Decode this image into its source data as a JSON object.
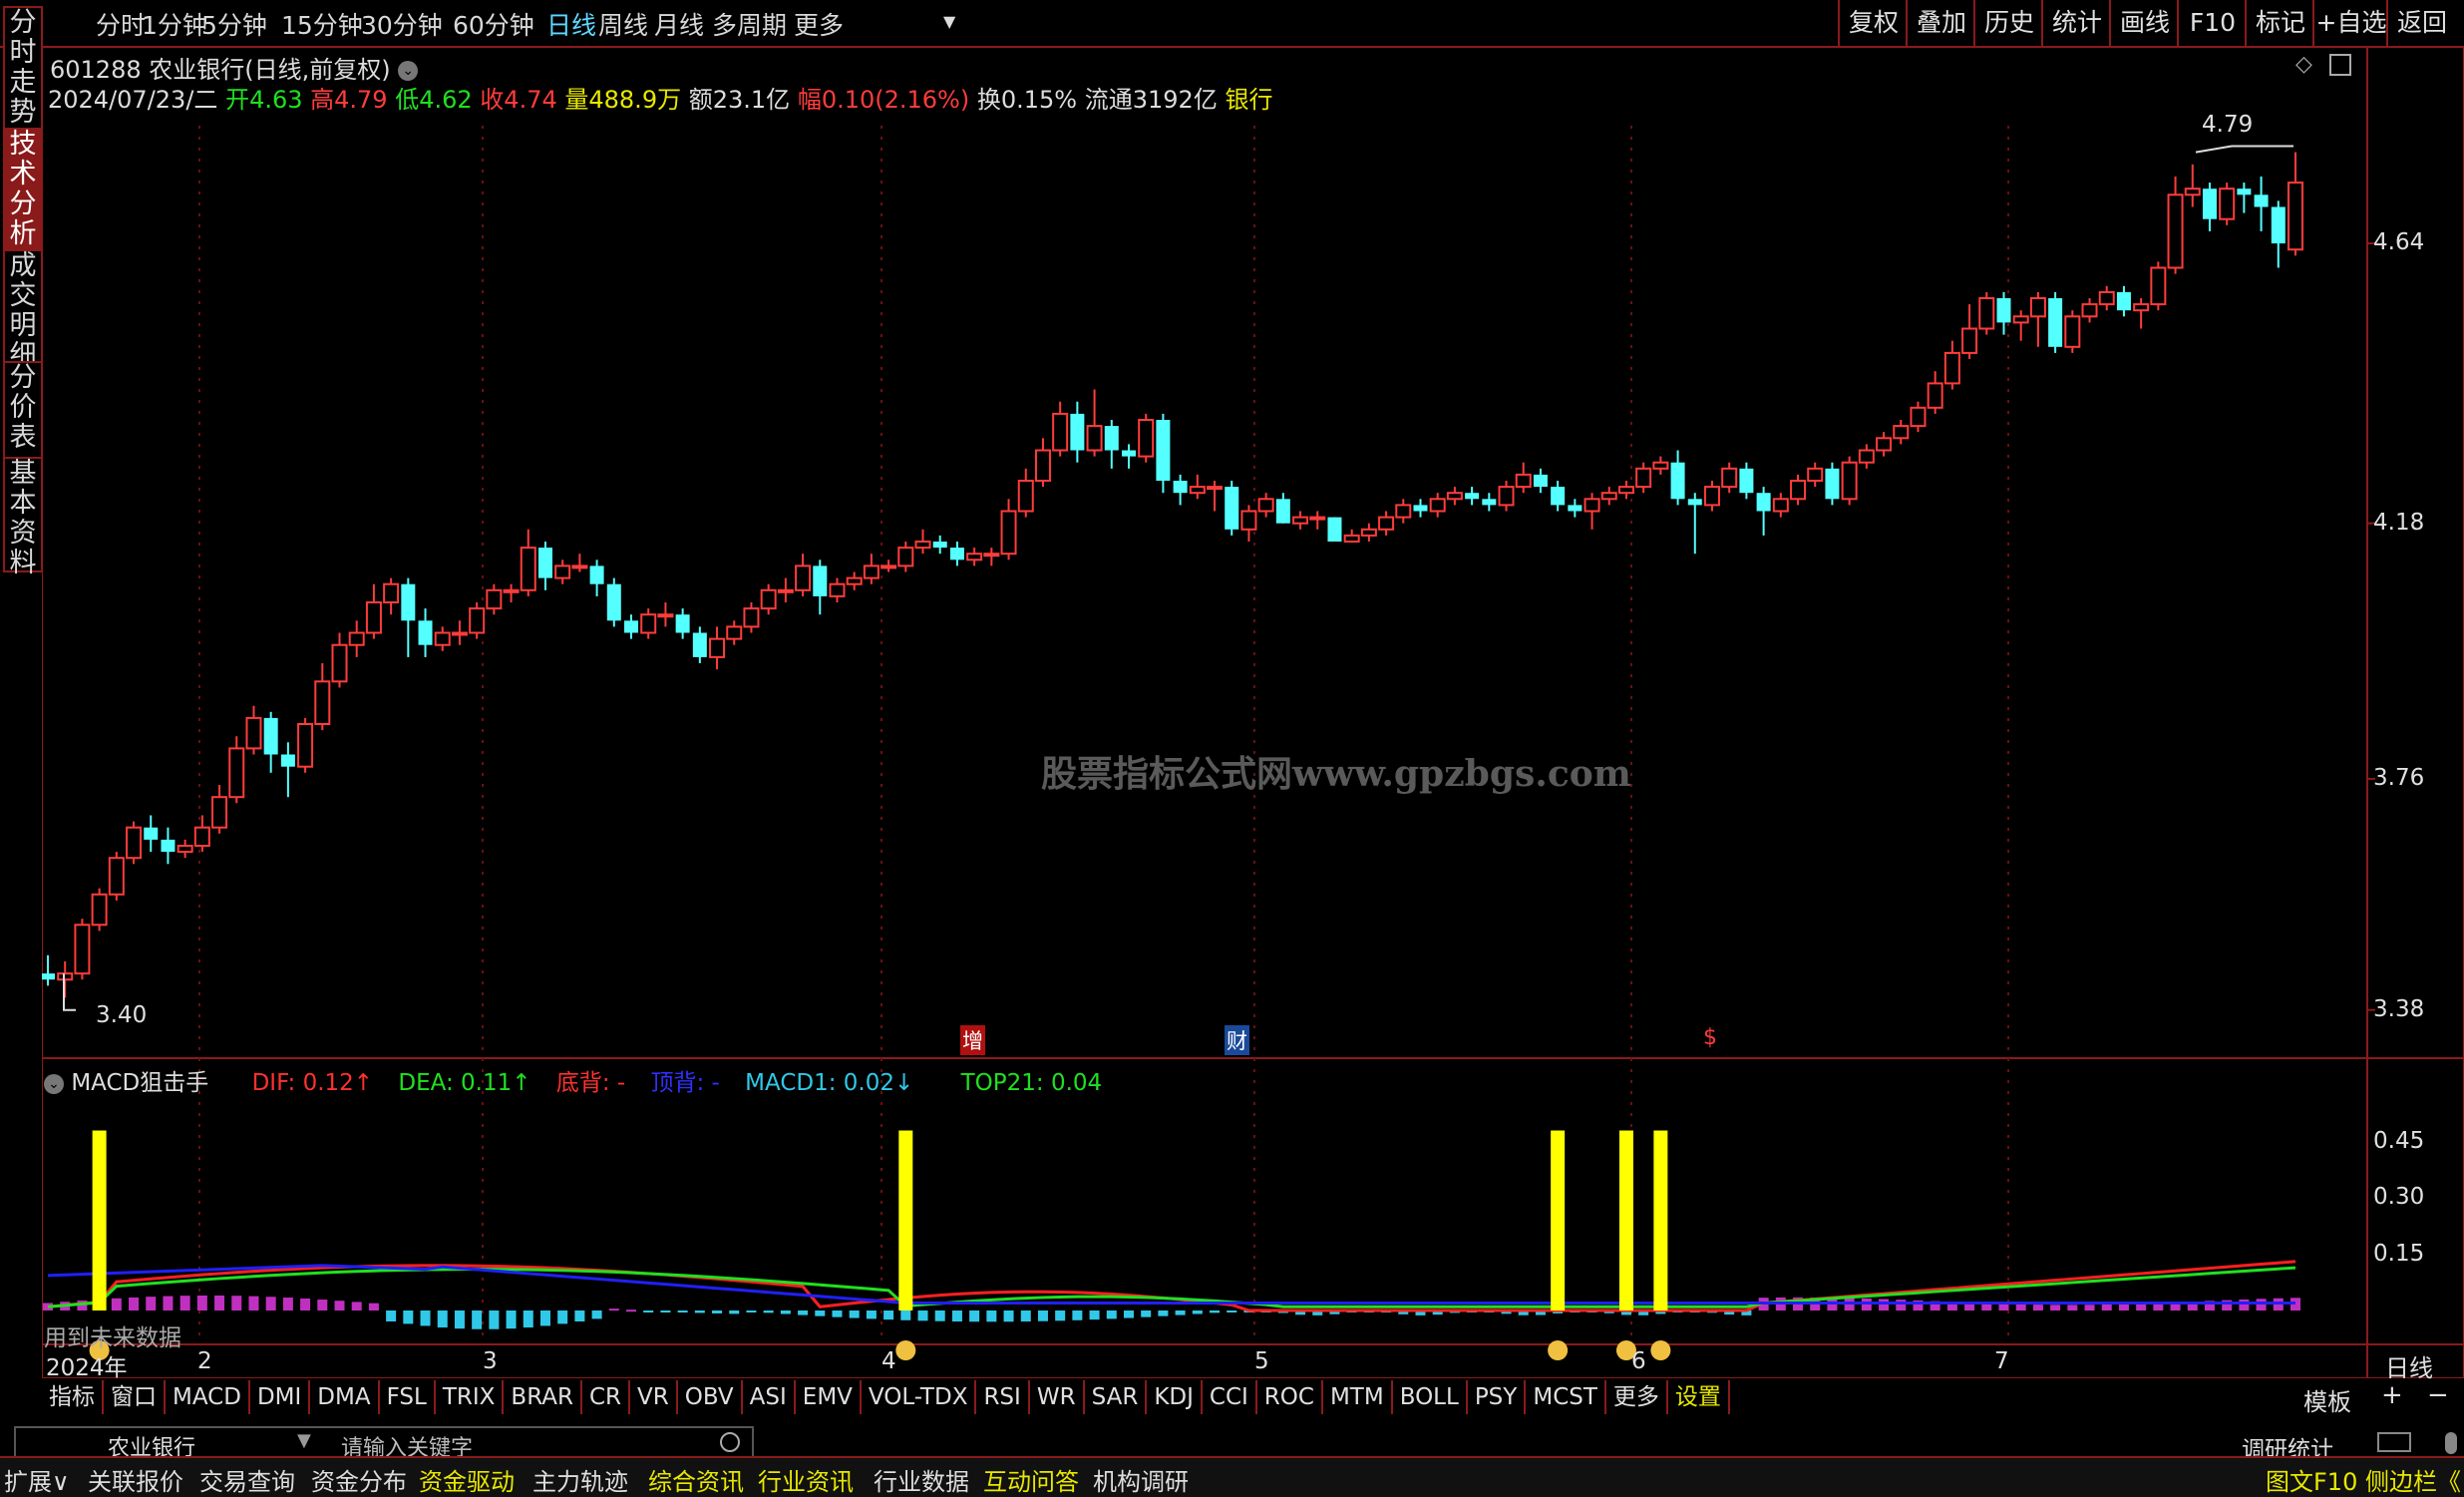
{
  "topbar": {
    "tabs": [
      "分时",
      "1分钟",
      "5分钟",
      "15分钟",
      "30分钟",
      "60分钟",
      "日线",
      "周线",
      "月线",
      "多周期",
      "更多"
    ],
    "active_tab": "日线",
    "right_buttons": [
      "复权",
      "叠加",
      "历史",
      "统计",
      "画线",
      "F10",
      "标记",
      "+自选",
      "返回"
    ]
  },
  "left_tabs": [
    "分时走势",
    "技术分析",
    "成交明细",
    "分价表",
    "基本资料"
  ],
  "left_active": "技术分析",
  "stock": {
    "code_name": "601288 农业银行(日线,前复权)",
    "date": "2024/07/23/二",
    "open_label": "开",
    "open": "4.63",
    "high_label": "高",
    "high": "4.79",
    "low_label": "低",
    "low": "4.62",
    "close_label": "收",
    "close": "4.74",
    "vol_label": "量",
    "vol": "488.9万",
    "amount_label": "额",
    "amount": "23.1亿",
    "change_label": "幅",
    "change": "0.10(2.16%)",
    "turnover": "换0.15%",
    "float_label": "流通",
    "float": "3192亿",
    "sector": "银行"
  },
  "watermark": "股票指标公式网www.gpzbgs.com",
  "price_axis": [
    "4.64",
    "4.18",
    "3.76",
    "3.38"
  ],
  "marks": {
    "low": "3.40",
    "high": "4.79",
    "zeng": "增",
    "cai": "财",
    "s": "$"
  },
  "macd": {
    "name": "MACD狙击手",
    "dif": "DIF: 0.12↑",
    "dea": "DEA: 0.11↑",
    "dibei": "底背: -",
    "dingbei": "顶背: -",
    "macd1": "MACD1: 0.02↓",
    "top21": "TOP21: 0.04",
    "axis": [
      "0.45",
      "0.30",
      "0.15"
    ],
    "note": "用到未来数据"
  },
  "x_axis": {
    "labels": [
      "2024年",
      "2",
      "3",
      "4",
      "5",
      "6",
      "7"
    ],
    "period": "日线"
  },
  "indicator_tabs": [
    "指标",
    "窗口",
    "MACD",
    "DMI",
    "DMA",
    "FSL",
    "TRIX",
    "BRAR",
    "CR",
    "VR",
    "OBV",
    "ASI",
    "EMV",
    "VOL-TDX",
    "RSI",
    "WR",
    "SAR",
    "KDJ",
    "CCI",
    "ROC",
    "MTM",
    "BOLL",
    "PSY",
    "MCST",
    "更多",
    "设置"
  ],
  "template_btn": "模板",
  "search": {
    "name": "农业银行",
    "placeholder": "请输入关键字",
    "right": "调研统计"
  },
  "bottom_tabs": [
    "扩展∨",
    "关联报价",
    "交易查询",
    "资金分布",
    "资金驱动",
    "主力轨迹",
    "综合资讯",
    "行业资讯",
    "行业数据",
    "互动问答",
    "机构调研"
  ],
  "bottom_right": [
    "图文F10",
    "侧边栏《"
  ],
  "colors": {
    "up": "#ff3c3c",
    "down": "#54ffff",
    "border": "#8b1a1a",
    "dif": "#ff2020",
    "dea": "#20e020",
    "yellow": "#ffff00"
  },
  "chart_data": {
    "type": "candlestick",
    "ylim": [
      3.35,
      4.85
    ],
    "candles": [
      [
        3.44,
        3.43,
        3.47,
        3.42
      ],
      [
        3.43,
        3.44,
        3.46,
        3.4
      ],
      [
        3.44,
        3.52,
        3.53,
        3.43
      ],
      [
        3.52,
        3.57,
        3.58,
        3.51
      ],
      [
        3.57,
        3.63,
        3.64,
        3.56
      ],
      [
        3.63,
        3.68,
        3.69,
        3.62
      ],
      [
        3.68,
        3.66,
        3.7,
        3.64
      ],
      [
        3.66,
        3.64,
        3.68,
        3.62
      ],
      [
        3.64,
        3.65,
        3.66,
        3.63
      ],
      [
        3.65,
        3.68,
        3.7,
        3.64
      ],
      [
        3.68,
        3.73,
        3.75,
        3.67
      ],
      [
        3.73,
        3.81,
        3.83,
        3.72
      ],
      [
        3.81,
        3.86,
        3.88,
        3.8
      ],
      [
        3.86,
        3.8,
        3.87,
        3.77
      ],
      [
        3.8,
        3.78,
        3.82,
        3.73
      ],
      [
        3.78,
        3.85,
        3.86,
        3.77
      ],
      [
        3.85,
        3.92,
        3.95,
        3.84
      ],
      [
        3.92,
        3.98,
        4.0,
        3.91
      ],
      [
        3.98,
        4.0,
        4.02,
        3.96
      ],
      [
        4.0,
        4.05,
        4.08,
        3.99
      ],
      [
        4.05,
        4.08,
        4.09,
        4.03
      ],
      [
        4.08,
        4.02,
        4.09,
        3.96
      ],
      [
        4.02,
        3.98,
        4.04,
        3.96
      ],
      [
        3.98,
        4.0,
        4.01,
        3.97
      ],
      [
        4.0,
        4.0,
        4.02,
        3.98
      ],
      [
        4.0,
        4.04,
        4.05,
        3.99
      ],
      [
        4.04,
        4.07,
        4.08,
        4.03
      ],
      [
        4.07,
        4.07,
        4.08,
        4.05
      ],
      [
        4.07,
        4.14,
        4.17,
        4.06
      ],
      [
        4.14,
        4.09,
        4.15,
        4.07
      ],
      [
        4.09,
        4.11,
        4.12,
        4.08
      ],
      [
        4.11,
        4.11,
        4.13,
        4.1
      ],
      [
        4.11,
        4.08,
        4.12,
        4.06
      ],
      [
        4.08,
        4.02,
        4.09,
        4.01
      ],
      [
        4.02,
        4.0,
        4.03,
        3.99
      ],
      [
        4.0,
        4.03,
        4.04,
        3.99
      ],
      [
        4.03,
        4.03,
        4.05,
        4.01
      ],
      [
        4.03,
        4.0,
        4.04,
        3.99
      ],
      [
        4.0,
        3.96,
        4.01,
        3.95
      ],
      [
        3.96,
        3.99,
        4.01,
        3.94
      ],
      [
        3.99,
        4.01,
        4.02,
        3.98
      ],
      [
        4.01,
        4.04,
        4.05,
        4.0
      ],
      [
        4.04,
        4.07,
        4.08,
        4.03
      ],
      [
        4.07,
        4.07,
        4.09,
        4.05
      ],
      [
        4.07,
        4.11,
        4.13,
        4.06
      ],
      [
        4.11,
        4.06,
        4.12,
        4.03
      ],
      [
        4.06,
        4.08,
        4.09,
        4.05
      ],
      [
        4.08,
        4.09,
        4.1,
        4.07
      ],
      [
        4.09,
        4.11,
        4.13,
        4.08
      ],
      [
        4.11,
        4.11,
        4.12,
        4.1
      ],
      [
        4.11,
        4.14,
        4.15,
        4.1
      ],
      [
        4.14,
        4.15,
        4.17,
        4.13
      ],
      [
        4.15,
        4.14,
        4.16,
        4.13
      ],
      [
        4.14,
        4.12,
        4.15,
        4.11
      ],
      [
        4.12,
        4.13,
        4.14,
        4.11
      ],
      [
        4.13,
        4.13,
        4.14,
        4.11
      ],
      [
        4.13,
        4.2,
        4.22,
        4.12
      ],
      [
        4.2,
        4.25,
        4.27,
        4.19
      ],
      [
        4.25,
        4.3,
        4.32,
        4.24
      ],
      [
        4.3,
        4.36,
        4.38,
        4.29
      ],
      [
        4.36,
        4.3,
        4.38,
        4.28
      ],
      [
        4.3,
        4.34,
        4.4,
        4.29
      ],
      [
        4.34,
        4.3,
        4.35,
        4.27
      ],
      [
        4.3,
        4.29,
        4.31,
        4.27
      ],
      [
        4.29,
        4.35,
        4.36,
        4.28
      ],
      [
        4.35,
        4.25,
        4.36,
        4.23
      ],
      [
        4.25,
        4.23,
        4.26,
        4.21
      ],
      [
        4.23,
        4.24,
        4.26,
        4.22
      ],
      [
        4.24,
        4.24,
        4.25,
        4.2
      ],
      [
        4.24,
        4.17,
        4.25,
        4.16
      ],
      [
        4.17,
        4.2,
        4.21,
        4.15
      ],
      [
        4.2,
        4.22,
        4.23,
        4.19
      ],
      [
        4.22,
        4.18,
        4.23,
        4.18
      ],
      [
        4.18,
        4.19,
        4.2,
        4.17
      ],
      [
        4.19,
        4.19,
        4.2,
        4.17
      ],
      [
        4.19,
        4.15,
        4.19,
        4.15
      ],
      [
        4.15,
        4.16,
        4.17,
        4.15
      ],
      [
        4.16,
        4.17,
        4.18,
        4.15
      ],
      [
        4.17,
        4.19,
        4.2,
        4.16
      ],
      [
        4.19,
        4.21,
        4.22,
        4.18
      ],
      [
        4.21,
        4.2,
        4.22,
        4.19
      ],
      [
        4.2,
        4.22,
        4.23,
        4.19
      ],
      [
        4.22,
        4.23,
        4.24,
        4.21
      ],
      [
        4.23,
        4.22,
        4.24,
        4.21
      ],
      [
        4.22,
        4.21,
        4.23,
        4.2
      ],
      [
        4.21,
        4.24,
        4.25,
        4.2
      ],
      [
        4.24,
        4.26,
        4.28,
        4.23
      ],
      [
        4.26,
        4.24,
        4.27,
        4.23
      ],
      [
        4.24,
        4.21,
        4.25,
        4.2
      ],
      [
        4.21,
        4.2,
        4.22,
        4.19
      ],
      [
        4.2,
        4.22,
        4.23,
        4.17
      ],
      [
        4.22,
        4.23,
        4.24,
        4.21
      ],
      [
        4.23,
        4.24,
        4.25,
        4.22
      ],
      [
        4.24,
        4.27,
        4.28,
        4.23
      ],
      [
        4.27,
        4.28,
        4.29,
        4.26
      ],
      [
        4.28,
        4.22,
        4.3,
        4.21
      ],
      [
        4.22,
        4.21,
        4.23,
        4.13
      ],
      [
        4.21,
        4.24,
        4.25,
        4.2
      ],
      [
        4.24,
        4.27,
        4.28,
        4.23
      ],
      [
        4.27,
        4.23,
        4.28,
        4.22
      ],
      [
        4.23,
        4.2,
        4.24,
        4.16
      ],
      [
        4.2,
        4.22,
        4.23,
        4.19
      ],
      [
        4.22,
        4.25,
        4.26,
        4.21
      ],
      [
        4.25,
        4.27,
        4.28,
        4.24
      ],
      [
        4.27,
        4.22,
        4.28,
        4.21
      ],
      [
        4.22,
        4.28,
        4.29,
        4.21
      ],
      [
        4.28,
        4.3,
        4.31,
        4.27
      ],
      [
        4.3,
        4.32,
        4.33,
        4.29
      ],
      [
        4.32,
        4.34,
        4.35,
        4.31
      ],
      [
        4.34,
        4.37,
        4.38,
        4.33
      ],
      [
        4.37,
        4.41,
        4.43,
        4.36
      ],
      [
        4.41,
        4.46,
        4.48,
        4.4
      ],
      [
        4.46,
        4.5,
        4.54,
        4.45
      ],
      [
        4.5,
        4.55,
        4.56,
        4.49
      ],
      [
        4.55,
        4.51,
        4.56,
        4.49
      ],
      [
        4.51,
        4.52,
        4.53,
        4.48
      ],
      [
        4.52,
        4.55,
        4.56,
        4.47
      ],
      [
        4.55,
        4.47,
        4.56,
        4.46
      ],
      [
        4.47,
        4.52,
        4.53,
        4.46
      ],
      [
        4.52,
        4.54,
        4.55,
        4.51
      ],
      [
        4.54,
        4.56,
        4.57,
        4.53
      ],
      [
        4.56,
        4.53,
        4.57,
        4.52
      ],
      [
        4.53,
        4.54,
        4.55,
        4.5
      ],
      [
        4.54,
        4.6,
        4.61,
        4.53
      ],
      [
        4.6,
        4.72,
        4.75,
        4.59
      ],
      [
        4.72,
        4.73,
        4.77,
        4.7
      ],
      [
        4.73,
        4.68,
        4.74,
        4.66
      ],
      [
        4.68,
        4.73,
        4.74,
        4.67
      ],
      [
        4.73,
        4.72,
        4.74,
        4.69
      ],
      [
        4.72,
        4.7,
        4.75,
        4.66
      ],
      [
        4.7,
        4.64,
        4.71,
        4.6
      ],
      [
        4.63,
        4.74,
        4.79,
        4.62
      ]
    ],
    "macd_spikes_index": [
      3,
      50,
      88,
      92,
      94
    ],
    "macd_axis": [
      0.45,
      0.3,
      0.15
    ]
  }
}
